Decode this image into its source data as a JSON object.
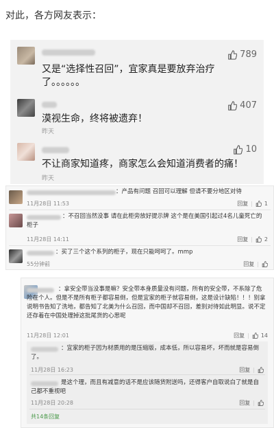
{
  "intro": "对此，各方网友表示：",
  "featured": [
    {
      "text": "又是“选择性召回”，宜家真是要放弃治疗了。。。。。。",
      "likes": "789",
      "time": ""
    },
    {
      "text": "漠视生命，终将被遗弃！",
      "likes": "407",
      "time": "昨天"
    },
    {
      "text": "不让商家知道疼，商家怎么会知道消费者的痛！",
      "likes": "10",
      "time": "昨天"
    }
  ],
  "thread1": [
    {
      "text": "：产品有问题 召回可以理解 但请不要分地区对待",
      "time": "11月28日 11:53",
      "reply": "回复",
      "likes": "1"
    },
    {
      "text": "：不召回当然没事 请在此柜旁放好提示牌 这个是在美国引起过4名儿童死亡的柜子",
      "time": "11月28日 14:11",
      "reply": "回复",
      "likes": "2"
    },
    {
      "text": "：买了三个这个系列的柜子，现在只能呵呵了。mmp",
      "time": "55分钟前",
      "reply": "回复",
      "likes": ""
    }
  ],
  "thread2": {
    "main_text": "：拿安全带当没事是嘛？安全带本身质量没有问题，所有的安全带，不系除了危险在个人。但是不是所有柜子都容易倒，但是宜家的柜子就容易倒，这是设计缺陷！！！别拿说明书告知了洗地，都告知了北美为什么召回，而中国却不召回，差别对待如此明显。说不定还存着在中国处理掉这批尾货的心思呢",
    "main_time": "11月28日 12:01",
    "main_reply": "回复",
    "main_likes": "14",
    "replies": [
      {
        "text": "：宜家的柜子因为材质用的是压缩版，成本低，所以容易坏，坏而就是容易倒了。",
        "time": "11月28日 16:23",
        "reply": "回复",
        "likes": ""
      },
      {
        "text": "是这个理，而且有减意的话不是应该随货附送吗，还得客户自取说白了就是自己都不重视吧",
        "time": "11月28日 20:28",
        "reply": "回复",
        "likes": ""
      }
    ],
    "more": "共14条回复"
  }
}
